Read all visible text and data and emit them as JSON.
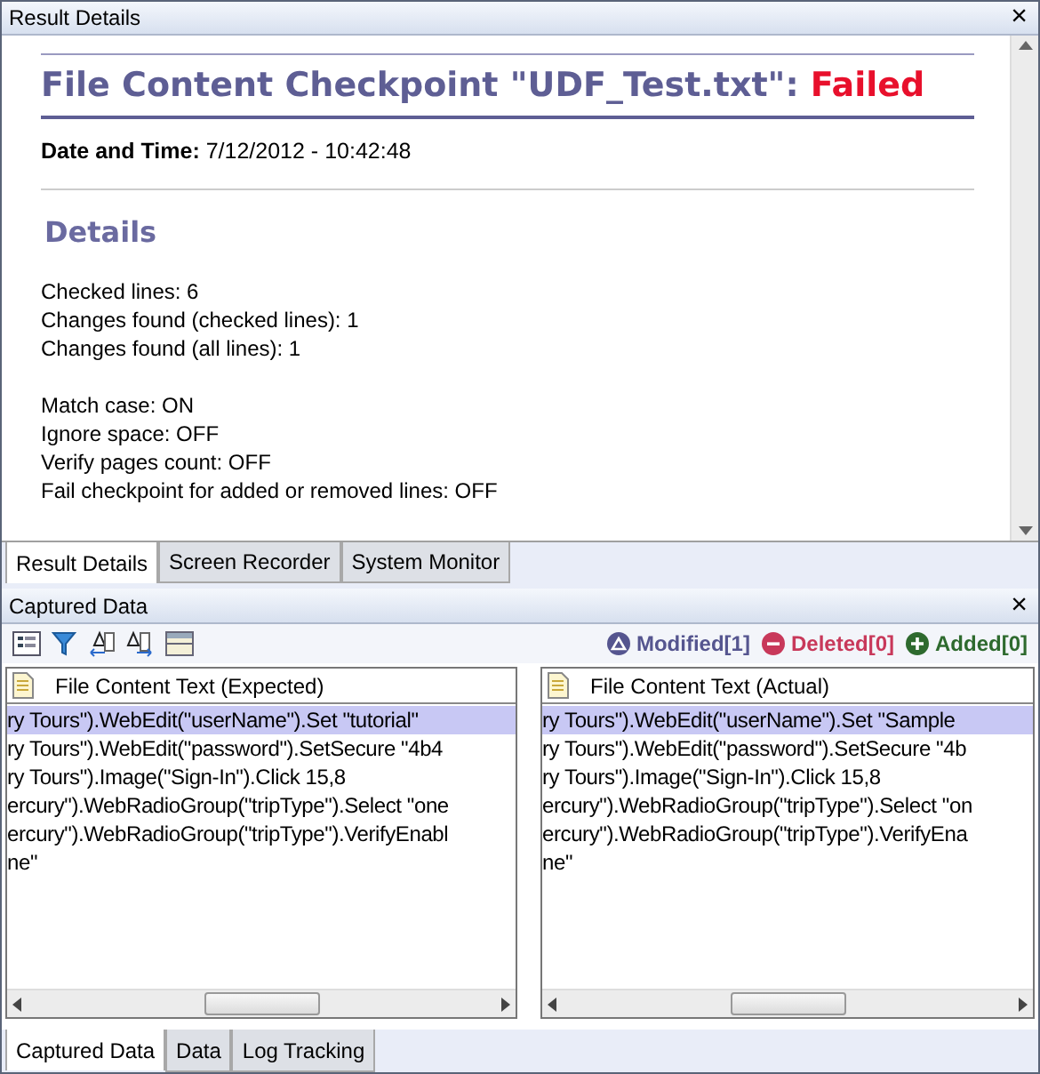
{
  "result_panel": {
    "title": "Result Details",
    "close": "×",
    "heading": {
      "text": "File Content Checkpoint \"UDF_Test.txt\": ",
      "status": "Failed"
    },
    "date_label": "Date and Time:",
    "date_value": "7/12/2012 - 10:42:48",
    "details_heading": "Details",
    "line_groups": [
      [
        "Checked lines: 6",
        "Changes found (checked lines): 1",
        "Changes found (all lines): 1"
      ],
      [
        "Match case: ON",
        "Ignore space: OFF",
        "Verify pages count: OFF",
        "Fail checkpoint for added or removed lines: OFF"
      ]
    ],
    "tabs": [
      {
        "label": "Result Details",
        "selected": true
      },
      {
        "label": "Screen Recorder",
        "selected": false
      },
      {
        "label": "System Monitor",
        "selected": false
      }
    ]
  },
  "captured_panel": {
    "title": "Captured Data",
    "close": "×",
    "legend": [
      {
        "label": "Modified[1]",
        "kind": "modified",
        "color": "#55558f"
      },
      {
        "label": "Deleted[0]",
        "kind": "deleted",
        "color": "#c8385a"
      },
      {
        "label": "Added[0]",
        "kind": "added",
        "color": "#2e6a2e"
      }
    ],
    "panes": [
      {
        "header": "File Content Text (Expected)",
        "rows": [
          {
            "text": "ry Tours\").WebEdit(\"userName\").Set \"tutorial\"",
            "selected": true
          },
          {
            "text": "ry Tours\").WebEdit(\"password\").SetSecure \"4b4",
            "selected": false
          },
          {
            "text": "ry Tours\").Image(\"Sign-In\").Click 15,8",
            "selected": false
          },
          {
            "text": "ercury\").WebRadioGroup(\"tripType\").Select \"one",
            "selected": false
          },
          {
            "text": "ercury\").WebRadioGroup(\"tripType\").VerifyEnabl",
            "selected": false
          },
          {
            "text": "ne\"",
            "selected": false
          }
        ]
      },
      {
        "header": "File Content Text (Actual)",
        "rows": [
          {
            "text": "ry Tours\").WebEdit(\"userName\").Set \"Sample",
            "selected": true
          },
          {
            "text": "ry Tours\").WebEdit(\"password\").SetSecure \"4b",
            "selected": false
          },
          {
            "text": "ry Tours\").Image(\"Sign-In\").Click 15,8",
            "selected": false
          },
          {
            "text": "ercury\").WebRadioGroup(\"tripType\").Select \"on",
            "selected": false
          },
          {
            "text": "ercury\").WebRadioGroup(\"tripType\").VerifyEna",
            "selected": false
          },
          {
            "text": "ne\"",
            "selected": false
          }
        ]
      }
    ],
    "tabs": [
      {
        "label": "Captured Data",
        "selected": true
      },
      {
        "label": "Data",
        "selected": false
      },
      {
        "label": "Log Tracking",
        "selected": false
      }
    ]
  }
}
